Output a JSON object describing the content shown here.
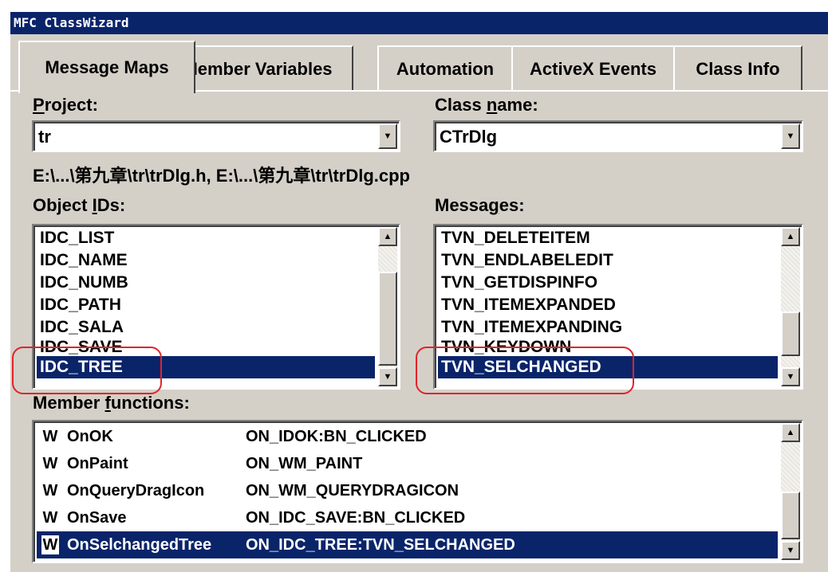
{
  "window": {
    "title": "MFC ClassWizard"
  },
  "tabs": [
    "Message Maps",
    "Member Variables",
    "Automation",
    "ActiveX Events",
    "Class Info"
  ],
  "project": {
    "label_u": "P",
    "label_rest": "roject:",
    "value": "tr"
  },
  "class_name": {
    "label_pre": "Class ",
    "label_u": "n",
    "label_rest": "ame:",
    "value": "CTrDlg"
  },
  "file_path": "E:\\...\\第九章\\tr\\trDlg.h, E:\\...\\第九章\\tr\\trDlg.cpp",
  "object_ids": {
    "label_pre": "Object ",
    "label_u": "I",
    "label_rest": "Ds:",
    "items": [
      "IDC_LIST",
      "IDC_NAME",
      "IDC_NUMB",
      "IDC_PATH",
      "IDC_SALA",
      "IDC_SAVE",
      "IDC_TREE"
    ],
    "selected": "IDC_TREE"
  },
  "messages": {
    "label_pre": "Messa",
    "label_u": "g",
    "label_rest": "es:",
    "items": [
      "TVN_DELETEITEM",
      "TVN_ENDLABELEDIT",
      "TVN_GETDISPINFO",
      "TVN_ITEMEXPANDED",
      "TVN_ITEMEXPANDING",
      "TVN_KEYDOWN",
      "TVN_SELCHANGED"
    ],
    "selected": "TVN_SELCHANGED"
  },
  "member_functions": {
    "label_pre": "Member ",
    "label_u": "f",
    "label_rest": "unctions:",
    "rows": [
      {
        "type": "W",
        "name": "OnOK",
        "map": "ON_IDOK:BN_CLICKED"
      },
      {
        "type": "W",
        "name": "OnPaint",
        "map": "ON_WM_PAINT"
      },
      {
        "type": "W",
        "name": "OnQueryDragIcon",
        "map": "ON_WM_QUERYDRAGICON"
      },
      {
        "type": "W",
        "name": "OnSave",
        "map": "ON_IDC_SAVE:BN_CLICKED"
      },
      {
        "type": "W",
        "name": "OnSelchangedTree",
        "map": "ON_IDC_TREE:TVN_SELCHANGED"
      }
    ]
  },
  "colors": {
    "selection": "#0a246a",
    "annotation": "#e0242a",
    "face": "#d4d0c8"
  },
  "icons": {
    "dropdown": "triangle-down",
    "scroll_up": "triangle-up",
    "scroll_down": "triangle-down"
  }
}
